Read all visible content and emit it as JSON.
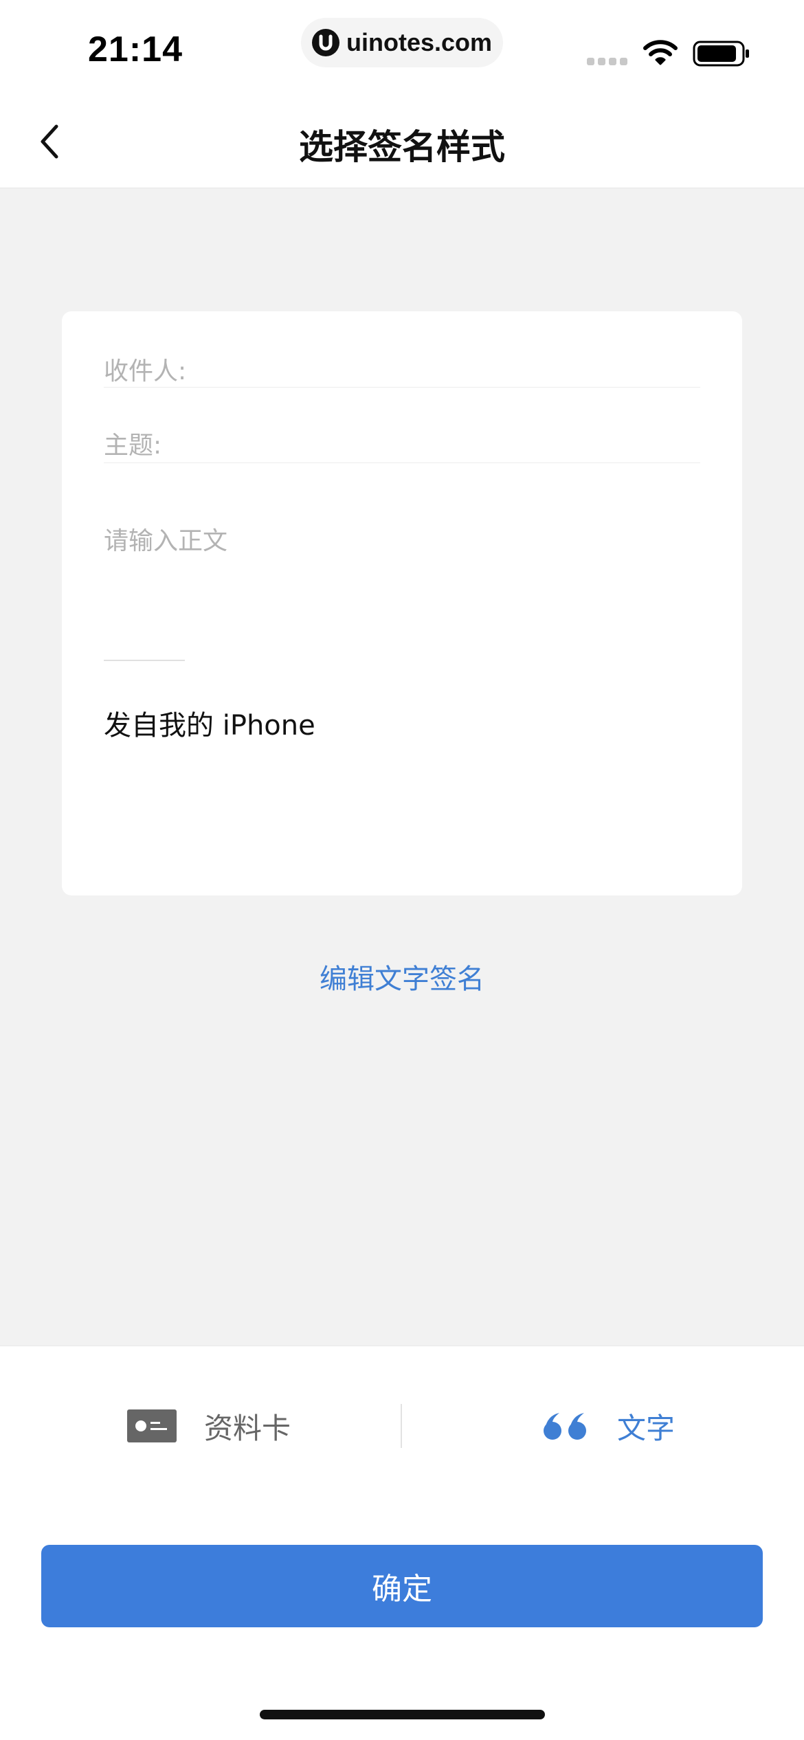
{
  "status_bar": {
    "time": "21:14",
    "url": "uinotes.com",
    "url_logo_letter": "U"
  },
  "nav": {
    "title": "选择签名样式"
  },
  "preview": {
    "recipient_label": "收件人:",
    "subject_label": "主题:",
    "body_placeholder": "请输入正文",
    "signature": "发自我的 iPhone"
  },
  "edit_signature_link": "编辑文字签名",
  "style_tabs": [
    {
      "label": "资料卡",
      "icon": "contact-card-icon",
      "selected": false
    },
    {
      "label": "文字",
      "icon": "quote-icon",
      "selected": true
    }
  ],
  "confirm_button": "确定",
  "colors": {
    "accent": "#3d7ddb",
    "link": "#3f7fd4",
    "background": "#f2f2f2"
  }
}
